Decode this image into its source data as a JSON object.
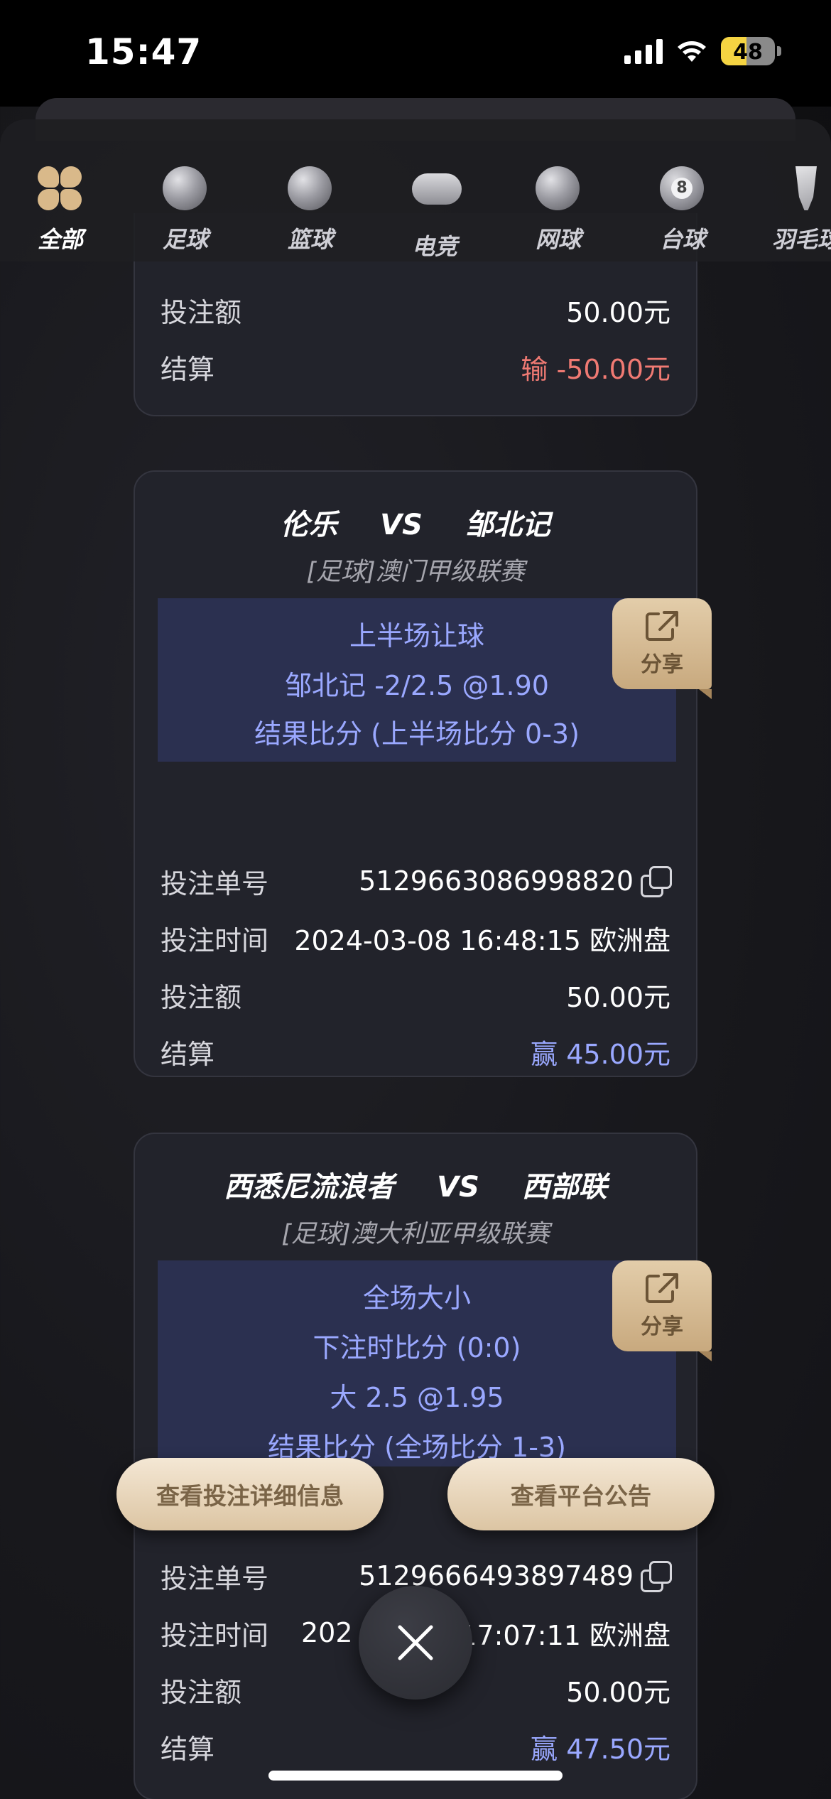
{
  "status_bar": {
    "time": "15:47",
    "battery": "48",
    "battery_level": 0.48
  },
  "tabs": [
    {
      "label": "全部",
      "icon": "clover-icon",
      "active": true
    },
    {
      "label": "足球",
      "icon": "football-icon"
    },
    {
      "label": "篮球",
      "icon": "basketball-icon"
    },
    {
      "label": "电竞",
      "icon": "gamepad-icon"
    },
    {
      "label": "网球",
      "icon": "tennis-icon"
    },
    {
      "label": "台球",
      "icon": "billiards-icon"
    },
    {
      "label": "羽毛球",
      "icon": "badminton-icon"
    }
  ],
  "card1": {
    "amount_label": "投注额",
    "amount": "50.00元",
    "settle_label": "结算",
    "settle": "输 -50.00元"
  },
  "card2": {
    "home": "伦乐",
    "vs": "VS",
    "away": "邹北记",
    "league": "[足球]澳门甲级联赛",
    "bet_lines": [
      "上半场让球",
      "邹北记  -2/2.5 @1.90",
      "结果比分 (上半场比分 0-3)"
    ],
    "share": "分享",
    "order_label": "投注单号",
    "order": "5129663086998820",
    "time_label": "投注时间",
    "time": "2024-03-08 16:48:15 欧洲盘",
    "amount_label": "投注额",
    "amount": "50.00元",
    "settle_label": "结算",
    "settle": "赢 45.00元"
  },
  "card3": {
    "home": "西悉尼流浪者",
    "vs": "VS",
    "away": "西部联",
    "league": "[足球]澳大利亚甲级联赛",
    "bet_lines": [
      "全场大小",
      "下注时比分 (0:0)",
      "大 2.5 @1.95",
      "结果比分 (全场比分 1-3)"
    ],
    "share": "分享",
    "order_label": "投注单号",
    "order": "5129666493897489",
    "time_label": "投注时间",
    "time_left": "202",
    "time_right": "17:07:11 欧洲盘",
    "amount_label": "投注额",
    "amount": "50.00元",
    "settle_label": "结算",
    "settle": "赢 47.50元"
  },
  "actions": {
    "details": "查看投注详细信息",
    "notice": "查看平台公告"
  }
}
